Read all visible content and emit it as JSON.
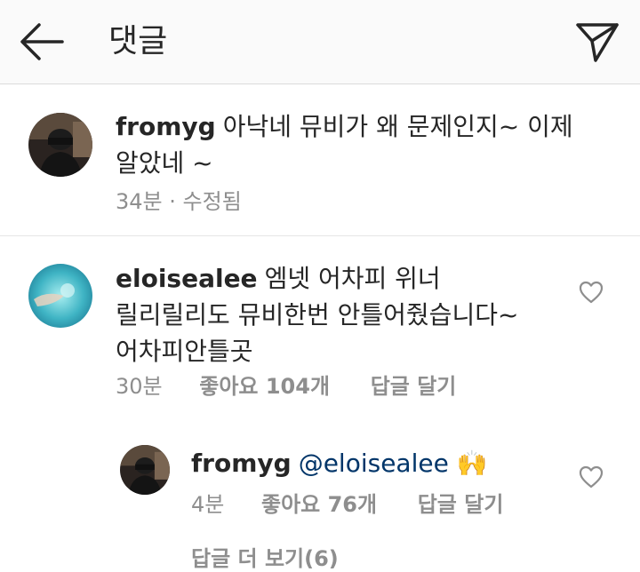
{
  "header": {
    "title": "댓글",
    "back_icon": "arrow-left-icon",
    "send_icon": "paper-plane-icon"
  },
  "comments": [
    {
      "username": "fromyg",
      "text": "아낙네 뮤비가 왜 문제인지~ 이제",
      "text_line2": "알았네 ~",
      "time": "34분",
      "dot": "·",
      "edited": "수정됨"
    },
    {
      "username": "eloisealee",
      "text": "엠넷 어차피 위너",
      "text_line2": "릴리릴리도 뮤비한번 안틀어줬습니다~",
      "text_line3": "어차피안틀곳",
      "time": "30분",
      "likes": "좋아요 104개",
      "reply": "답글 달기"
    }
  ],
  "reply": {
    "username": "fromyg",
    "mention": "@eloisealee",
    "emoji": "🙌",
    "time": "4분",
    "likes": "좋아요 76개",
    "reply": "답글 달기"
  },
  "footer": {
    "view_replies": "답글 더 보기(6)"
  },
  "colors": {
    "header_bg": "#fafafa",
    "text": "#262626",
    "meta": "#8e8e8e",
    "mention": "#003569"
  }
}
